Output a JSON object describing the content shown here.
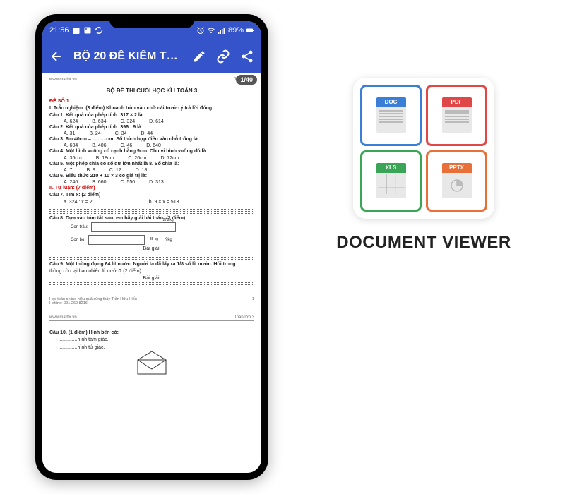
{
  "status": {
    "time": "21:56",
    "battery": "89%"
  },
  "appbar": {
    "title": "BỘ 20 ĐỀ KIỂM TR..."
  },
  "page_badge": "1/40",
  "doc": {
    "site": "www.mathx.vn",
    "grade": "Toán lớp 3",
    "title": "BỘ ĐỀ THI CUỐI HỌC KÌ I TOÁN 3",
    "exam_label": "ĐỀ SỐ 1",
    "sec1": "I. Trắc nghiệm: (3 điểm) Khoanh tròn vào chữ cái trước ý trả lời đúng:",
    "q1": "Câu 1. Kết quả của phép tính: 317 × 2 là:",
    "q1_opts": {
      "a": "A. 624",
      "b": "B. 634",
      "c": "C. 324",
      "d": "D. 614"
    },
    "q2": "Câu 2. Kết quả của phép tính: 396 : 9 là:",
    "q2_opts": {
      "a": "A. 31",
      "b": "B. 24",
      "c": "C. 34",
      "d": "D. 44"
    },
    "q3": "Câu 3. 6m 40cm = ..........cm. Số thích hợp điền vào chỗ trống là:",
    "q3_opts": {
      "a": "A. 604",
      "b": "B. 406",
      "c": "C. 46",
      "d": "D. 640"
    },
    "q4": "Câu 4. Một hình vuông có cạnh bằng 9cm. Chu vi hình vuông đó là:",
    "q4_opts": {
      "a": "A. 36cm",
      "b": "B. 18cm",
      "c": "C. 26cm",
      "d": "D. 72cm"
    },
    "q5": "Câu 5. Một phép chia có số dư lớn nhất là 8. Số chia là:",
    "q5_opts": {
      "a": "A. 7",
      "b": "B. 9",
      "c": "C. 12",
      "d": "D. 18"
    },
    "q6": "Câu 6. Biểu thức 210 + 10 × 3 có giá trị là:",
    "q6_opts": {
      "a": "A. 240",
      "b": "B. 660",
      "c": "C. 550",
      "d": "D. 313"
    },
    "sec2": "II. Tự luận: (7 điểm)",
    "q7": "Câu 7. Tìm x: (2 điểm)",
    "q7a": "a. 324 : x = 2",
    "q7b": "b. 9 × x = 513",
    "q8": "Câu 8. Dựa vào tóm tắt sau, em hãy giải bài toán: (2 điểm)",
    "q8_trau": "Con trâu:",
    "q8_bo": "Con bò:",
    "q8_val1": "276 kg",
    "q8_val2": "85 kg",
    "q8_q": "?kg",
    "bai_giai": "Bài giải:",
    "q9_a": "Câu 9. Một thùng đựng 64 lít nước. Người ta đã lấy ra ",
    "q9_frac": "1/8",
    "q9_b": " số lít nước. Hỏi trong",
    "q9_c": "thùng còn lại bao nhiêu lít nước? (2 điểm)",
    "footer1": "Học toán online hiệu quả cùng thầy Trần Hữu Hiếu",
    "footer2": "Hotline: 091.269.8216",
    "footer_page": "1",
    "q10": "Câu 10. (1 điểm) Hình bên có:",
    "q10a": "- .............hình tam giác.",
    "q10b": "- .............hình tứ giác."
  },
  "logo": {
    "doc": "DOC",
    "pdf": "PDF",
    "xls": "XLS",
    "pptx": "PPTX"
  },
  "app_name": "DOCUMENT VIEWER"
}
